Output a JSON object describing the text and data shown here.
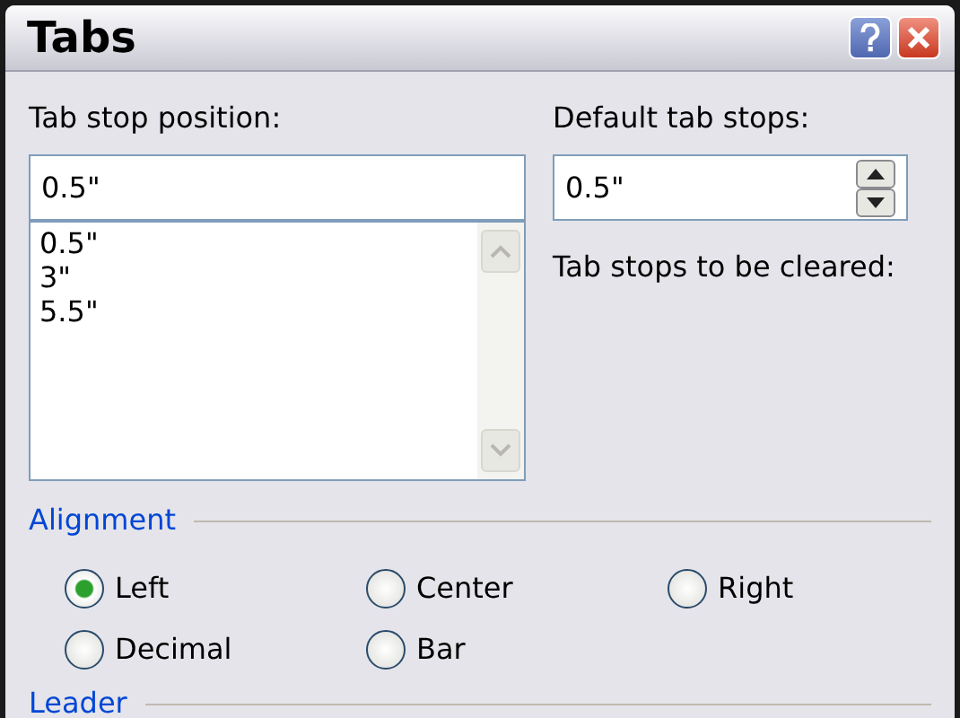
{
  "window": {
    "title": "Tabs"
  },
  "tab_stop_position": {
    "label": "Tab stop position:",
    "value": "0.5\"",
    "items": [
      "0.5\"",
      "3\"",
      "5.5\""
    ]
  },
  "default_tab_stops": {
    "label": "Default tab stops:",
    "value": "0.5\""
  },
  "tab_stops_to_be_cleared": {
    "label": "Tab stops to be cleared:"
  },
  "alignment": {
    "legend": "Alignment",
    "options": [
      {
        "label": "Left",
        "selected": true
      },
      {
        "label": "Center",
        "selected": false
      },
      {
        "label": "Right",
        "selected": false
      },
      {
        "label": "Decimal",
        "selected": false
      },
      {
        "label": "Bar",
        "selected": false
      }
    ]
  },
  "leader": {
    "legend": "Leader"
  }
}
